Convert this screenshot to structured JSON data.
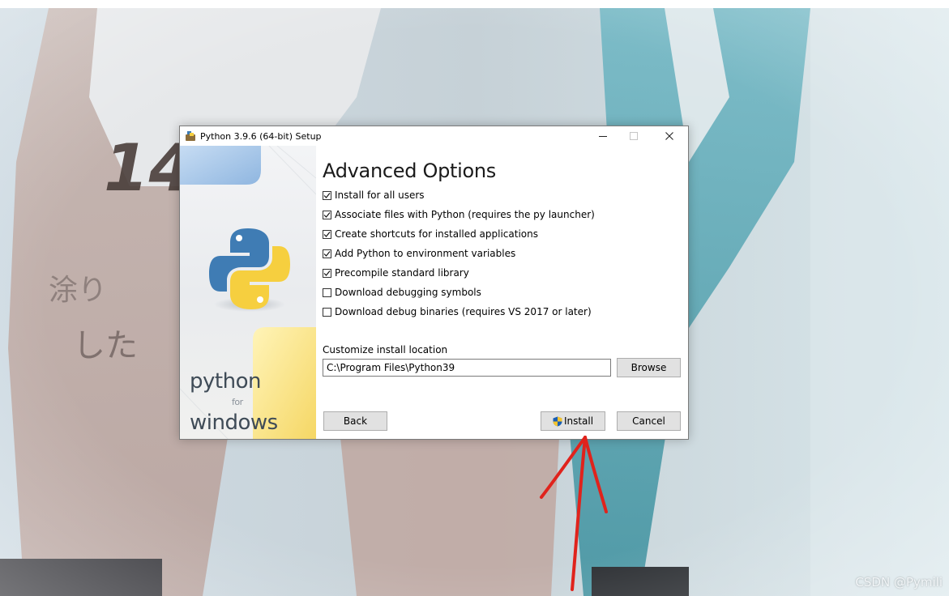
{
  "window": {
    "title": "Python 3.9.6 (64-bit) Setup"
  },
  "banner": {
    "word_top": "python",
    "word_mid": "for",
    "word_bottom": "windows"
  },
  "page": {
    "heading": "Advanced Options"
  },
  "options": [
    {
      "label": "Install for all users",
      "checked": true
    },
    {
      "label": "Associate files with Python (requires the py launcher)",
      "checked": true
    },
    {
      "label": "Create shortcuts for installed applications",
      "checked": true
    },
    {
      "label": "Add Python to environment variables",
      "checked": true
    },
    {
      "label": "Precompile standard library",
      "checked": true
    },
    {
      "label": "Download debugging symbols",
      "checked": false
    },
    {
      "label": "Download debug binaries (requires VS 2017 or later)",
      "checked": false
    }
  ],
  "location": {
    "label": "Customize install location",
    "value": "C:\\Program Files\\Python39"
  },
  "buttons": {
    "browse": "Browse",
    "back": "Back",
    "install": "Install",
    "cancel": "Cancel"
  },
  "watermark": "CSDN @Pymili",
  "colors": {
    "annotation_arrow": "#e0231c",
    "python_blue": "#3f7cb4",
    "python_yellow": "#f6cf3f",
    "shield_blue": "#1a5fb4",
    "shield_yellow": "#f4c430"
  }
}
